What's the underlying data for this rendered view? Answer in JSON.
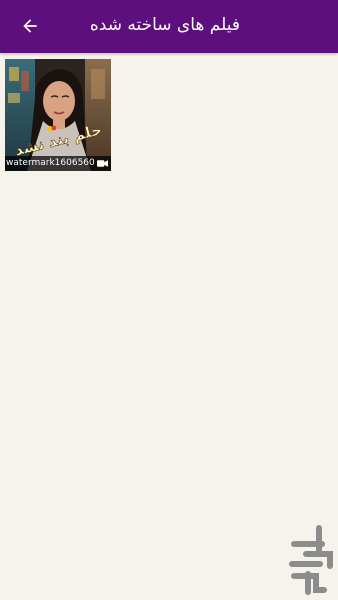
{
  "app_bar": {
    "title": "فیلم های ساخته شده",
    "back_icon": "arrow-back-icon",
    "background_color": "#5d0f7d"
  },
  "videos": [
    {
      "filename": "watermark1606560...",
      "overlay_text": "حلم بند نشد",
      "type_icon": "video-camera-icon"
    }
  ],
  "page": {
    "background_color": "#f6f2ec"
  },
  "watermark": {
    "icon": "store-logo-icon"
  }
}
